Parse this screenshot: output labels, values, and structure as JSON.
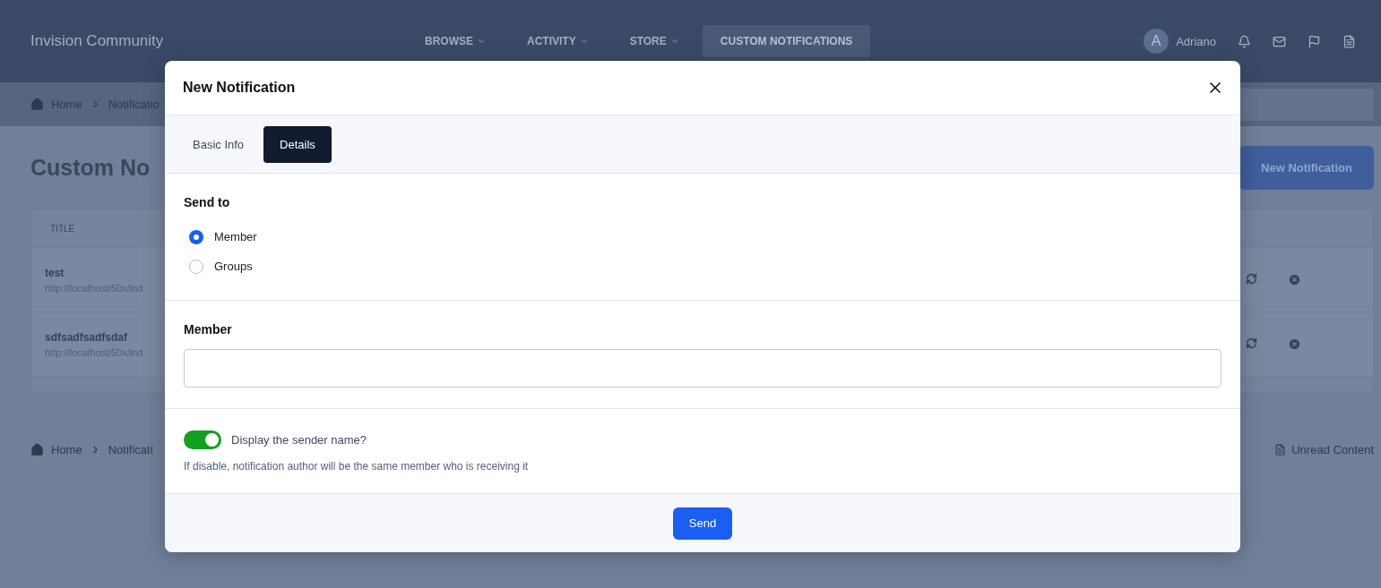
{
  "header": {
    "logo": "Invision Community",
    "nav": [
      {
        "label": "BROWSE",
        "dropdown": true,
        "selected": false
      },
      {
        "label": "ACTIVITY",
        "dropdown": true,
        "selected": false
      },
      {
        "label": "STORE",
        "dropdown": true,
        "selected": false
      },
      {
        "label": "CUSTOM NOTIFICATIONS",
        "dropdown": false,
        "selected": true
      }
    ],
    "user": {
      "initial": "A",
      "name": "Adriano"
    }
  },
  "breadcrumb": [
    "Home",
    "Notificatio"
  ],
  "page": {
    "title": "Custom No",
    "new_button": "New Notification",
    "table": {
      "columns": [
        "TITLE"
      ],
      "rows": [
        {
          "title": "test",
          "url": "http://localhost/50x/ind"
        },
        {
          "title": "sdfsadfsadfsdaf",
          "url": "http://localhost/50x/ind"
        }
      ]
    }
  },
  "footer": {
    "breadcrumb": [
      "Home",
      "Notificati"
    ],
    "link": "Unread Content"
  },
  "modal": {
    "title": "New Notification",
    "tabs": [
      {
        "label": "Basic Info",
        "selected": false
      },
      {
        "label": "Details",
        "selected": true
      }
    ],
    "send_to": {
      "label": "Send to",
      "options": [
        {
          "label": "Member",
          "selected": true
        },
        {
          "label": "Groups",
          "selected": false
        }
      ]
    },
    "member": {
      "label": "Member"
    },
    "toggle": {
      "label": "Display the sender name?",
      "on": true,
      "description": "If disable, notification author will be the same member who is receiving it"
    },
    "submit": "Send"
  }
}
